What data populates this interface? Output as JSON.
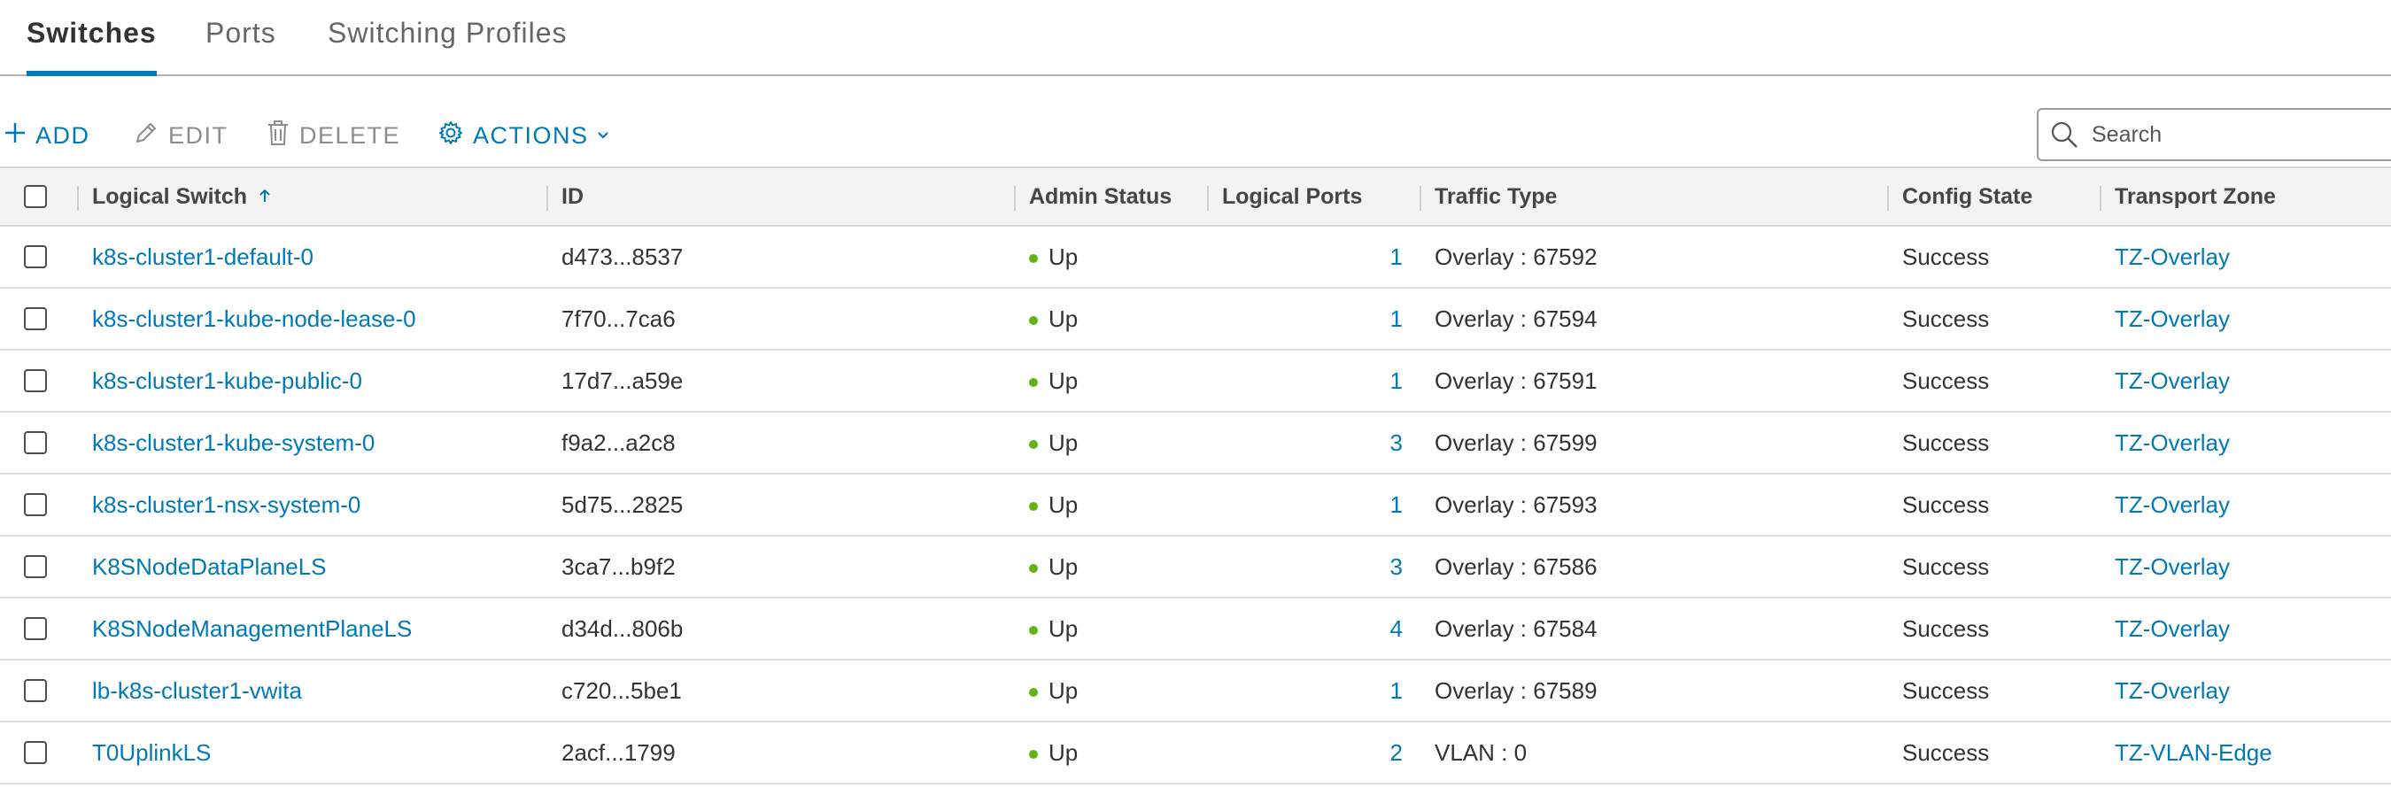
{
  "tabs": [
    {
      "label": "Switches",
      "active": true
    },
    {
      "label": "Ports",
      "active": false
    },
    {
      "label": "Switching Profiles",
      "active": false
    }
  ],
  "toolbar": {
    "add_label": "ADD",
    "edit_label": "EDIT",
    "delete_label": "DELETE",
    "actions_label": "ACTIONS",
    "search_placeholder": "Search"
  },
  "grid": {
    "columns": {
      "logical_switch": "Logical Switch",
      "id": "ID",
      "admin_status": "Admin Status",
      "logical_ports": "Logical Ports",
      "traffic_type": "Traffic Type",
      "config_state": "Config State",
      "transport_zone": "Transport Zone"
    },
    "sort": {
      "column": "Logical Switch",
      "direction": "ascending"
    },
    "rows": [
      {
        "name": "k8s-cluster1-default-0",
        "id": "d473...8537",
        "admin_status": "Up",
        "logical_ports": "1",
        "traffic_type": "Overlay : 67592",
        "config_state": "Success",
        "transport_zone": "TZ-Overlay"
      },
      {
        "name": "k8s-cluster1-kube-node-lease-0",
        "id": "7f70...7ca6",
        "admin_status": "Up",
        "logical_ports": "1",
        "traffic_type": "Overlay : 67594",
        "config_state": "Success",
        "transport_zone": "TZ-Overlay"
      },
      {
        "name": "k8s-cluster1-kube-public-0",
        "id": "17d7...a59e",
        "admin_status": "Up",
        "logical_ports": "1",
        "traffic_type": "Overlay : 67591",
        "config_state": "Success",
        "transport_zone": "TZ-Overlay"
      },
      {
        "name": "k8s-cluster1-kube-system-0",
        "id": "f9a2...a2c8",
        "admin_status": "Up",
        "logical_ports": "3",
        "traffic_type": "Overlay : 67599",
        "config_state": "Success",
        "transport_zone": "TZ-Overlay"
      },
      {
        "name": "k8s-cluster1-nsx-system-0",
        "id": "5d75...2825",
        "admin_status": "Up",
        "logical_ports": "1",
        "traffic_type": "Overlay : 67593",
        "config_state": "Success",
        "transport_zone": "TZ-Overlay"
      },
      {
        "name": "K8SNodeDataPlaneLS",
        "id": "3ca7...b9f2",
        "admin_status": "Up",
        "logical_ports": "3",
        "traffic_type": "Overlay : 67586",
        "config_state": "Success",
        "transport_zone": "TZ-Overlay"
      },
      {
        "name": "K8SNodeManagementPlaneLS",
        "id": "d34d...806b",
        "admin_status": "Up",
        "logical_ports": "4",
        "traffic_type": "Overlay : 67584",
        "config_state": "Success",
        "transport_zone": "TZ-Overlay"
      },
      {
        "name": "lb-k8s-cluster1-vwita",
        "id": "c720...5be1",
        "admin_status": "Up",
        "logical_ports": "1",
        "traffic_type": "Overlay : 67589",
        "config_state": "Success",
        "transport_zone": "TZ-Overlay"
      },
      {
        "name": "T0UplinkLS",
        "id": "2acf...1799",
        "admin_status": "Up",
        "logical_ports": "2",
        "traffic_type": "VLAN : 0",
        "config_state": "Success",
        "transport_zone": "TZ-VLAN-Edge"
      }
    ]
  },
  "icons": {
    "add": "plus-icon",
    "edit": "pencil-icon",
    "delete": "trash-icon",
    "actions": "gear-icon",
    "actions_caret": "chevron-down-icon",
    "search": "search-icon",
    "sort": "arrow-up-icon",
    "status": "status-dot-icon"
  },
  "colors": {
    "accent": "#0079b8",
    "status_up": "#60b515",
    "disabled": "#8c8c8c",
    "header_bg": "#f3f3f3"
  }
}
